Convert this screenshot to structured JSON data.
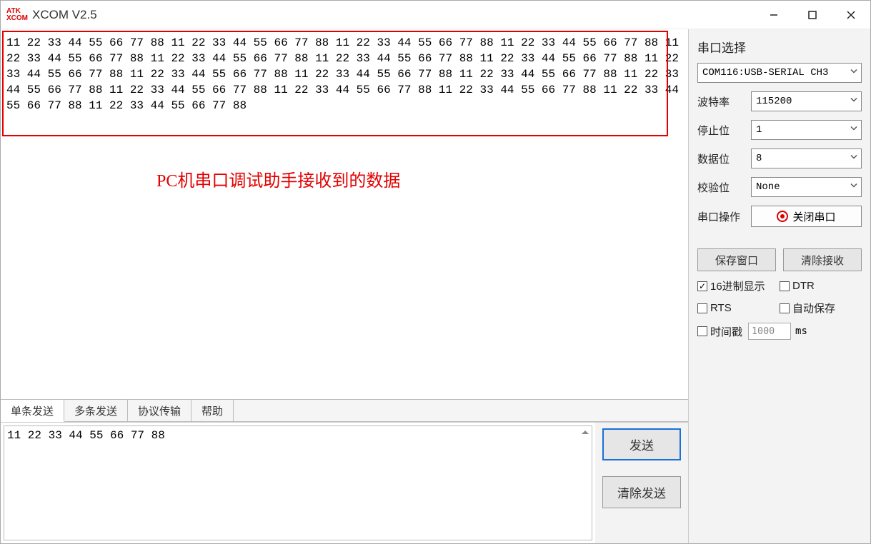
{
  "titlebar": {
    "logo_top": "ATK",
    "logo_bot": "XCOM",
    "title": "XCOM V2.5"
  },
  "rx": {
    "text": "11 22 33 44 55 66 77 88 11 22 33 44 55 66 77 88 11 22 33 44 55 66 77 88 11 22 33 44 55 66 77 88 11 22 33 44 55 66 77 88 11 22 33 44 55 66 77 88 11 22 33 44 55 66 77 88 11 22 33 44 55 66 77 88 11 22 33 44 55 66 77 88 11 22 33 44 55 66 77 88 11 22 33 44 55 66 77 88 11 22 33 44 55 66 77 88 11 22 33 44 55 66 77 88 11 22 33 44 55 66 77 88 11 22 33 44 55 66 77 88 11 22 33 44 55 66 77 88 11 22 33 44 55 66 77 88 11 22 33 44 55 66 77 88 ",
    "annotation": "PC机串口调试助手接收到的数据"
  },
  "tabs": {
    "items": [
      "单条发送",
      "多条发送",
      "协议传输",
      "帮助"
    ],
    "active": 0
  },
  "tx": {
    "value": "11 22 33 44 55 66 77 88",
    "send_label": "发送",
    "clear_label": "清除发送"
  },
  "side": {
    "section_title": "串口选择",
    "port": "COM116:USB-SERIAL CH3",
    "rows": {
      "baud_label": "波特率",
      "baud_value": "115200",
      "stop_label": "停止位",
      "stop_value": "1",
      "data_label": "数据位",
      "data_value": "8",
      "parity_label": "校验位",
      "parity_value": "None",
      "op_label": "串口操作",
      "op_button": "关闭串口"
    },
    "btns": {
      "save": "保存窗口",
      "clear_rx": "清除接收"
    },
    "checks": {
      "hex_display": "16进制显示",
      "dtr": "DTR",
      "rts": "RTS",
      "autosave": "自动保存",
      "timestamp": "时间戳",
      "ts_value": "1000",
      "ms": "ms"
    }
  }
}
